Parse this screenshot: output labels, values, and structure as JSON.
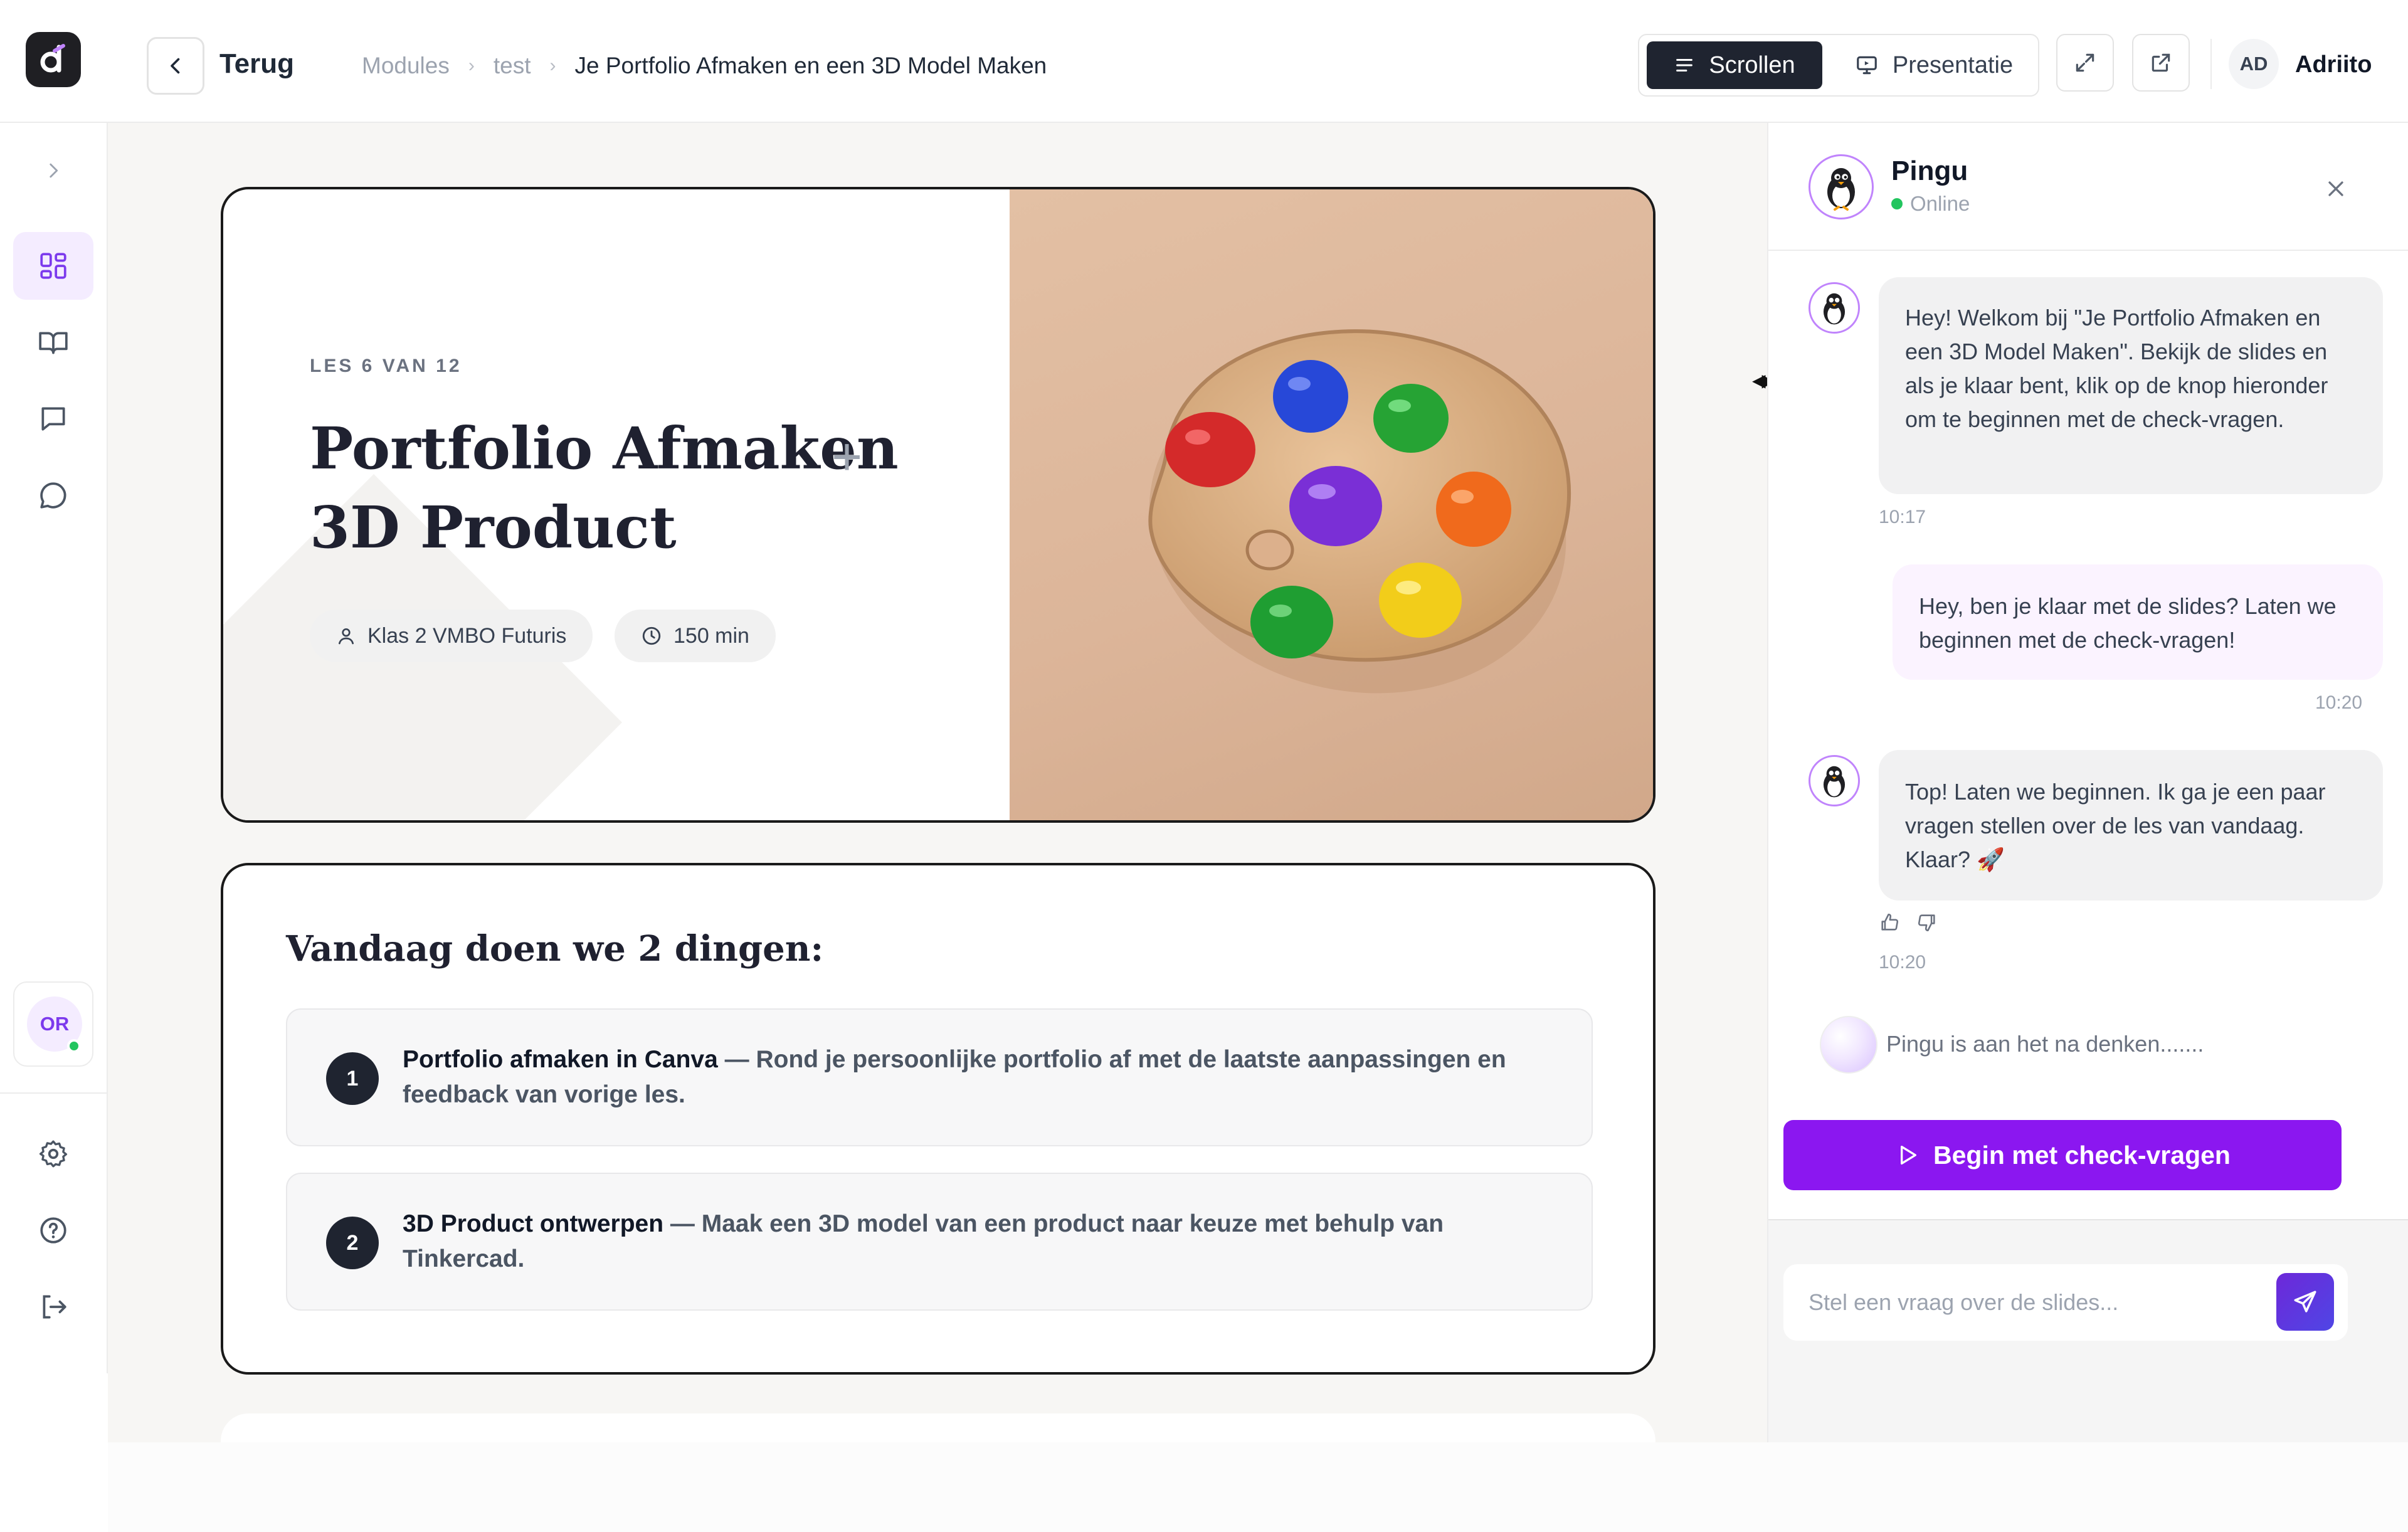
{
  "header": {
    "back_label": "Terug",
    "breadcrumbs": [
      "Modules",
      "test",
      "Je Portfolio Afmaken en een 3D Model Maken"
    ],
    "mode_scroll": "Scrollen",
    "mode_present": "Presentatie",
    "user_initials": "AD",
    "user_name": "Adriito"
  },
  "sidebar": {
    "items": [
      "chevron-right-icon",
      "dashboard-icon",
      "book-icon",
      "chat-square-icon",
      "chat-round-icon"
    ],
    "org_initials": "OR",
    "bottom_items": [
      "settings-icon",
      "help-icon",
      "logout-icon"
    ]
  },
  "hero": {
    "eyebrow": "LES 6 VAN 12",
    "title_line1": "Portfolio Afmaken",
    "title_line2": "3D Product",
    "plus": "+",
    "class_chip": "Klas 2 VMBO Futuris",
    "time_chip": "150 min"
  },
  "todo": {
    "title": "Vandaag doen we 2 dingen:",
    "items": [
      {
        "num": "1",
        "bold": "Portfolio afmaken in Canva",
        "rest": " — Rond je persoonlijke portfolio af met de laatste aanpassingen en feedback van vorige les."
      },
      {
        "num": "2",
        "bold": "3D Product ontwerpen",
        "rest": " — Maak een 3D model van een product naar keuze met behulp van Tinkercad."
      }
    ]
  },
  "chat": {
    "bot_name": "Pingu",
    "status": "Online",
    "messages": [
      {
        "from": "bot",
        "text": "Hey! Welkom bij \"Je Portfolio Afmaken en een 3D Model Maken\". Bekijk de slides en als je klaar bent, klik op de knop hieronder om te beginnen met de check-vragen.",
        "time": "10:17"
      },
      {
        "from": "user",
        "text": "Hey, ben je klaar met de slides? Laten we beginnen met de check-vragen!",
        "time": "10:20"
      },
      {
        "from": "bot",
        "text": "Top! Laten we beginnen. Ik ga je een paar vragen stellen over de les van vandaag. Klaar? 🚀",
        "time": "10:20"
      }
    ],
    "thinking": "Pingu is aan het na denken.......",
    "cta": "Begin met check-vragen",
    "input_placeholder": "Stel een vraag over de slides..."
  },
  "colors": {
    "accent": "#8b17f0",
    "dark": "#1f2430",
    "online": "#22c55e",
    "active_bg": "#f4ecff"
  }
}
